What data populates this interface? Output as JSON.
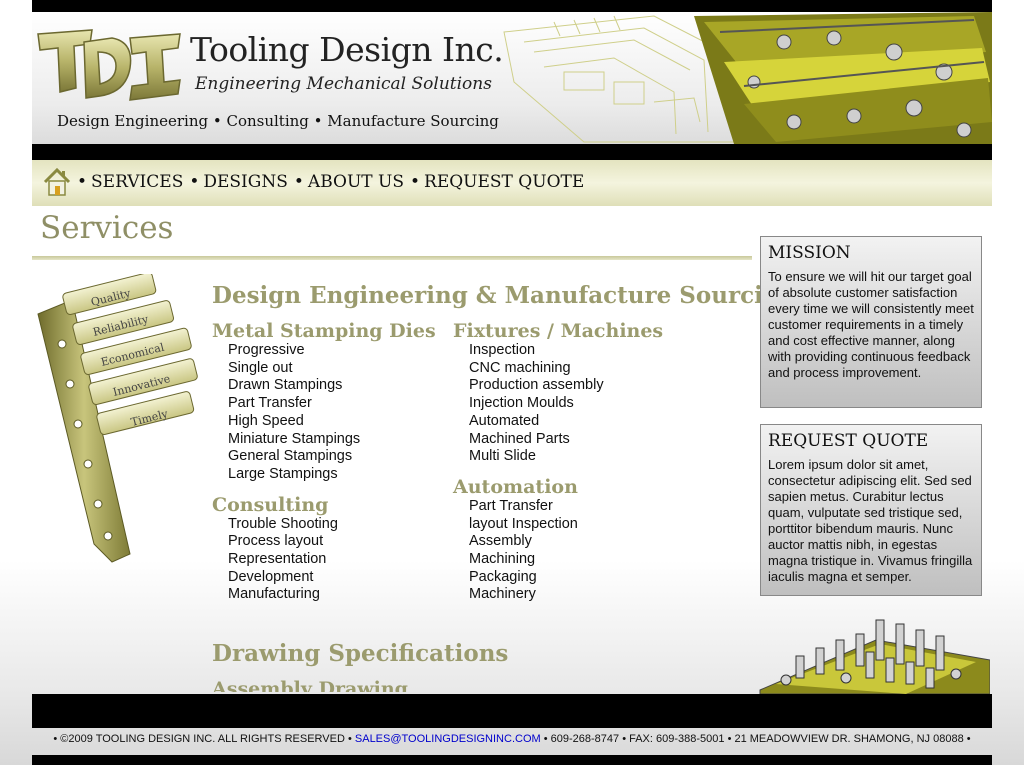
{
  "header": {
    "brand_title": "Tooling Design Inc.",
    "brand_subtitle": "Engineering Mechanical Solutions",
    "tagline": "Design Engineering • Consulting • Manufacture Sourcing",
    "logo_icon": "tdi-logo",
    "accent_color": "#b5b36a"
  },
  "nav": {
    "home_icon": "home-icon",
    "items": [
      {
        "label": "SERVICES"
      },
      {
        "label": "DESIGNS"
      },
      {
        "label": "ABOUT US"
      },
      {
        "label": "REQUEST QUOTE"
      }
    ],
    "separator": "•"
  },
  "page": {
    "title": "Services",
    "main_heading": "Design Engineering & Manufacture Sourcing",
    "ribbon_words": [
      "Quality",
      "Reliability",
      "Economical",
      "Innovative",
      "Timely"
    ],
    "sections_left": [
      {
        "heading": "Metal Stamping Dies",
        "items": [
          "Progressive",
          "Single out",
          "Drawn Stampings",
          "Part Transfer",
          "High Speed",
          "Miniature Stampings",
          "General Stampings",
          "Large Stampings"
        ]
      },
      {
        "heading": "Consulting",
        "items": [
          "Trouble Shooting",
          "Process layout",
          "Representation",
          "Development",
          "Manufacturing"
        ]
      }
    ],
    "sections_right": [
      {
        "heading": "Fixtures / Machines",
        "items": [
          "Inspection",
          "CNC machining",
          "Production assembly",
          "Injection Moulds",
          "Automated",
          "Machined Parts",
          "Multi Slide"
        ]
      },
      {
        "heading": "Automation",
        "items": [
          "Part Transfer",
          "layout Inspection",
          "Assembly",
          "Machining",
          "Packaging",
          "Machinery"
        ]
      }
    ],
    "drawing_heading": "Drawing Specifications",
    "assembly_heading": "Assembly Drawing"
  },
  "sidebar": {
    "mission": {
      "title": "MISSION",
      "text": "To ensure we will hit our target goal of absolute customer satisfaction every time we will consistently meet customer requirements in a timely and cost effective manner, along with providing continuous feedback and process improvement."
    },
    "quote": {
      "title": "REQUEST QUOTE",
      "text": "Lorem ipsum dolor sit amet, consectetur adipiscing elit. Sed sed sapien metus. Curabitur lectus quam, vulputate sed tristique sed, porttitor bibendum mauris. Nunc auctor mattis nibh, in egestas magna tristique in. Vivamus fringilla iaculis magna et semper."
    }
  },
  "footer": {
    "copyright": "• ©2009 TOOLING DESIGN INC. ALL RIGHTS RESERVED •",
    "email": "SALES@TOOLINGDESIGNINC.COM",
    "contact": "• 609-268-8747 • FAX: 609-388-5001 • 21 MEADOWVIEW DR. SHAMONG, NJ 08088 •"
  }
}
